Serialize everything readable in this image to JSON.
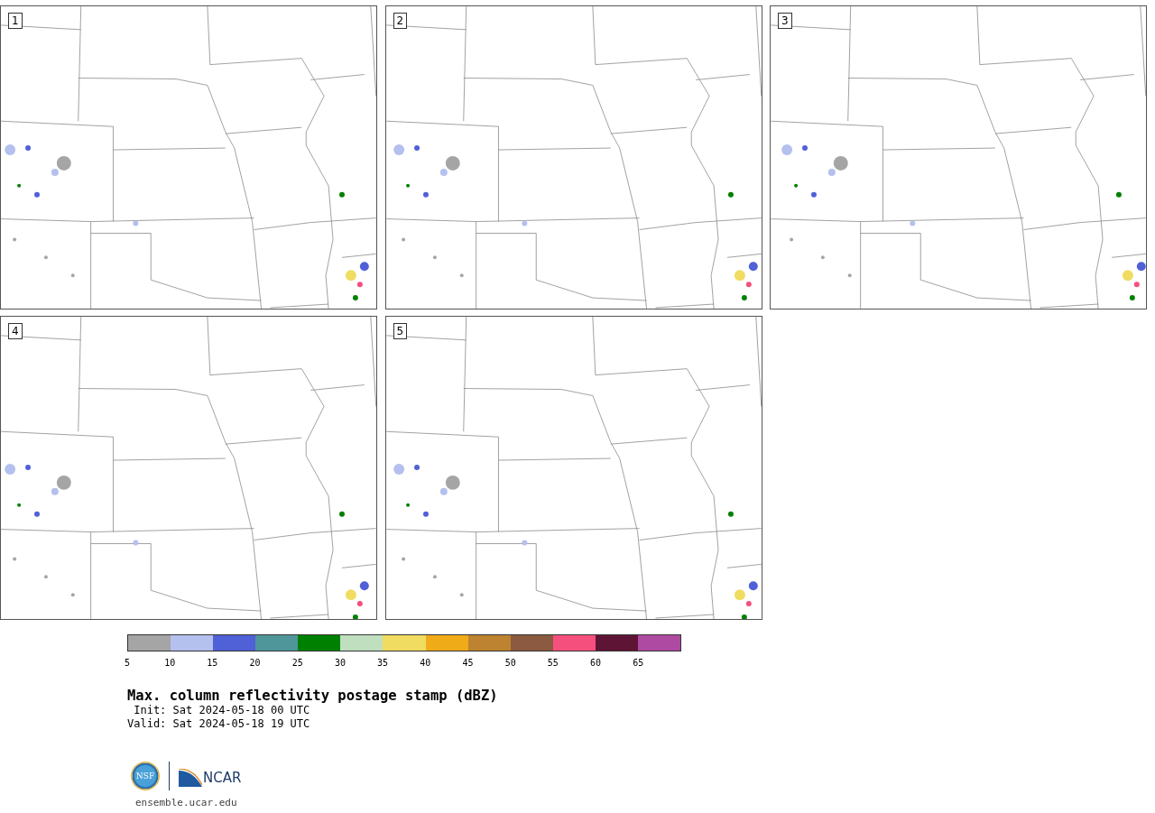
{
  "panels": [
    {
      "number": "1"
    },
    {
      "number": "2"
    },
    {
      "number": "3"
    },
    {
      "number": "4"
    },
    {
      "number": "5"
    }
  ],
  "colorbar": [
    {
      "label": "5",
      "color": "#a5a5a5"
    },
    {
      "label": "10",
      "color": "#b4c0ee"
    },
    {
      "label": "15",
      "color": "#5060d6"
    },
    {
      "label": "20",
      "color": "#4f969a"
    },
    {
      "label": "25",
      "color": "#008000"
    },
    {
      "label": "30",
      "color": "#bfdfbf"
    },
    {
      "label": "35",
      "color": "#f0dc60"
    },
    {
      "label": "40",
      "color": "#f0ab18"
    },
    {
      "label": "45",
      "color": "#bd8330"
    },
    {
      "label": "50",
      "color": "#8c5a40"
    },
    {
      "label": "55",
      "color": "#f5507d"
    },
    {
      "label": "60",
      "color": "#5e1535"
    },
    {
      "label": "65",
      "color": "#ae4aa2"
    }
  ],
  "title": "Max. column reflectivity postage stamp (dBZ)",
  "init": " Init: Sat 2024-05-18 00 UTC",
  "valid": "Valid: Sat 2024-05-18 19 UTC",
  "logo": {
    "nsf": "NSF",
    "ncar": "NCAR"
  },
  "url": "ensemble.ucar.edu"
}
